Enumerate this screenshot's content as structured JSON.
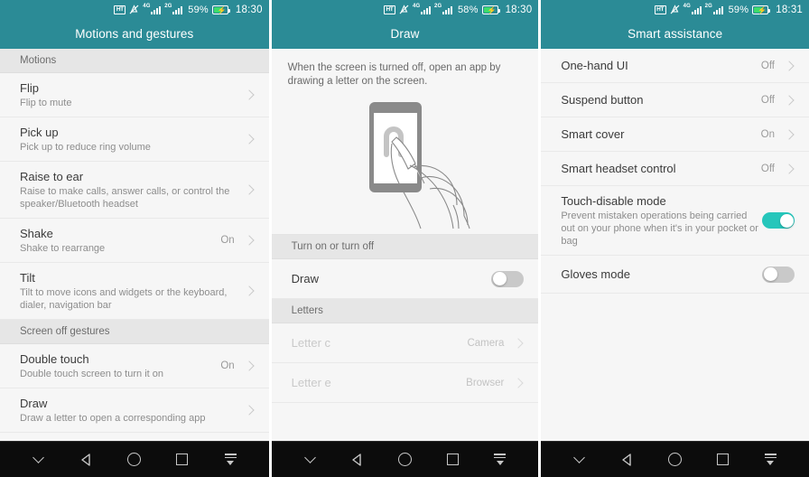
{
  "colors": {
    "appbar_teal": "#2b8b96",
    "toggle_on": "#26c6bb",
    "toggle_off": "#c9c9c9",
    "section_header_bg": "#e6e6e6",
    "row_bg": "#f6f6f6",
    "navbar_bg": "#0c0c0c",
    "battery_green": "#3ddc6b"
  },
  "screens": [
    {
      "status_bar": {
        "icons": [
          "hd-icon",
          "vibrate-mute-icon",
          "signal-4g-icon",
          "signal-2g-icon"
        ],
        "network_1_label": "4G",
        "network_2_label": "2G",
        "hd_label": "HT",
        "battery_percent": "59%",
        "clock": "18:30"
      },
      "title": "Motions and gestures",
      "sections": [
        {
          "header": "Motions",
          "rows": [
            {
              "title": "Flip",
              "subtitle": "Flip to mute",
              "value": "",
              "control": "chevron",
              "disabled": false
            },
            {
              "title": "Pick up",
              "subtitle": "Pick up to reduce ring volume",
              "value": "",
              "control": "chevron",
              "disabled": false
            },
            {
              "title": "Raise to ear",
              "subtitle": "Raise to make calls, answer calls, or control the speaker/Bluetooth headset",
              "value": "",
              "control": "chevron",
              "disabled": false
            },
            {
              "title": "Shake",
              "subtitle": "Shake to rearrange",
              "value": "On",
              "control": "chevron",
              "disabled": false
            },
            {
              "title": "Tilt",
              "subtitle": "Tilt to move icons and widgets or the keyboard, dialer, navigation bar",
              "value": "",
              "control": "chevron",
              "disabled": false
            }
          ]
        },
        {
          "header": "Screen off gestures",
          "rows": [
            {
              "title": "Double touch",
              "subtitle": "Double touch screen to turn it on",
              "value": "On",
              "control": "chevron",
              "disabled": false
            },
            {
              "title": "Draw",
              "subtitle": "Draw a letter to open a corresponding app",
              "value": "",
              "control": "chevron",
              "disabled": false
            }
          ]
        }
      ]
    },
    {
      "status_bar": {
        "icons": [
          "hd-icon",
          "vibrate-mute-icon",
          "signal-4g-icon",
          "signal-2g-icon"
        ],
        "network_1_label": "4G",
        "network_2_label": "2G",
        "hd_label": "HT",
        "battery_percent": "58%",
        "clock": "18:30"
      },
      "title": "Draw",
      "intro": "When the screen is turned off, open an app by drawing a letter on the screen.",
      "illustration": "hand-drawing-on-phone-illustration",
      "sections": [
        {
          "header": "Turn on or turn off",
          "rows": [
            {
              "title": "Draw",
              "subtitle": "",
              "value": "",
              "control": "toggle",
              "toggle_on": false,
              "disabled": false
            }
          ]
        },
        {
          "header": "Letters",
          "rows": [
            {
              "title": "Letter c",
              "subtitle": "",
              "value": "Camera",
              "control": "chevron",
              "disabled": true
            },
            {
              "title": "Letter e",
              "subtitle": "",
              "value": "Browser",
              "control": "chevron",
              "disabled": true
            }
          ]
        }
      ]
    },
    {
      "status_bar": {
        "icons": [
          "hd-icon",
          "vibrate-mute-icon",
          "signal-4g-icon",
          "signal-2g-icon"
        ],
        "network_1_label": "4G",
        "network_2_label": "2G",
        "hd_label": "HT",
        "battery_percent": "59%",
        "clock": "18:31"
      },
      "title": "Smart assistance",
      "sections": [
        {
          "header": "",
          "rows": [
            {
              "title": "One-hand UI",
              "subtitle": "",
              "value": "Off",
              "control": "chevron",
              "disabled": false
            },
            {
              "title": "Suspend button",
              "subtitle": "",
              "value": "Off",
              "control": "chevron",
              "disabled": false
            },
            {
              "title": "Smart cover",
              "subtitle": "",
              "value": "On",
              "control": "chevron",
              "disabled": false
            },
            {
              "title": "Smart headset control",
              "subtitle": "",
              "value": "Off",
              "control": "chevron",
              "disabled": false
            },
            {
              "title": "Touch-disable mode",
              "subtitle": "Prevent mistaken operations being carried out on your phone when it's in your pocket or bag",
              "value": "",
              "control": "toggle",
              "toggle_on": true,
              "disabled": false
            },
            {
              "title": "Gloves mode",
              "subtitle": "",
              "value": "",
              "control": "toggle",
              "toggle_on": false,
              "disabled": false
            }
          ]
        }
      ]
    }
  ],
  "navbar": {
    "buttons": [
      {
        "name": "chevron-down-icon",
        "label": ""
      },
      {
        "name": "back-icon",
        "label": ""
      },
      {
        "name": "home-icon",
        "label": ""
      },
      {
        "name": "recents-icon",
        "label": ""
      },
      {
        "name": "hide-navbar-icon",
        "label": ""
      }
    ]
  }
}
